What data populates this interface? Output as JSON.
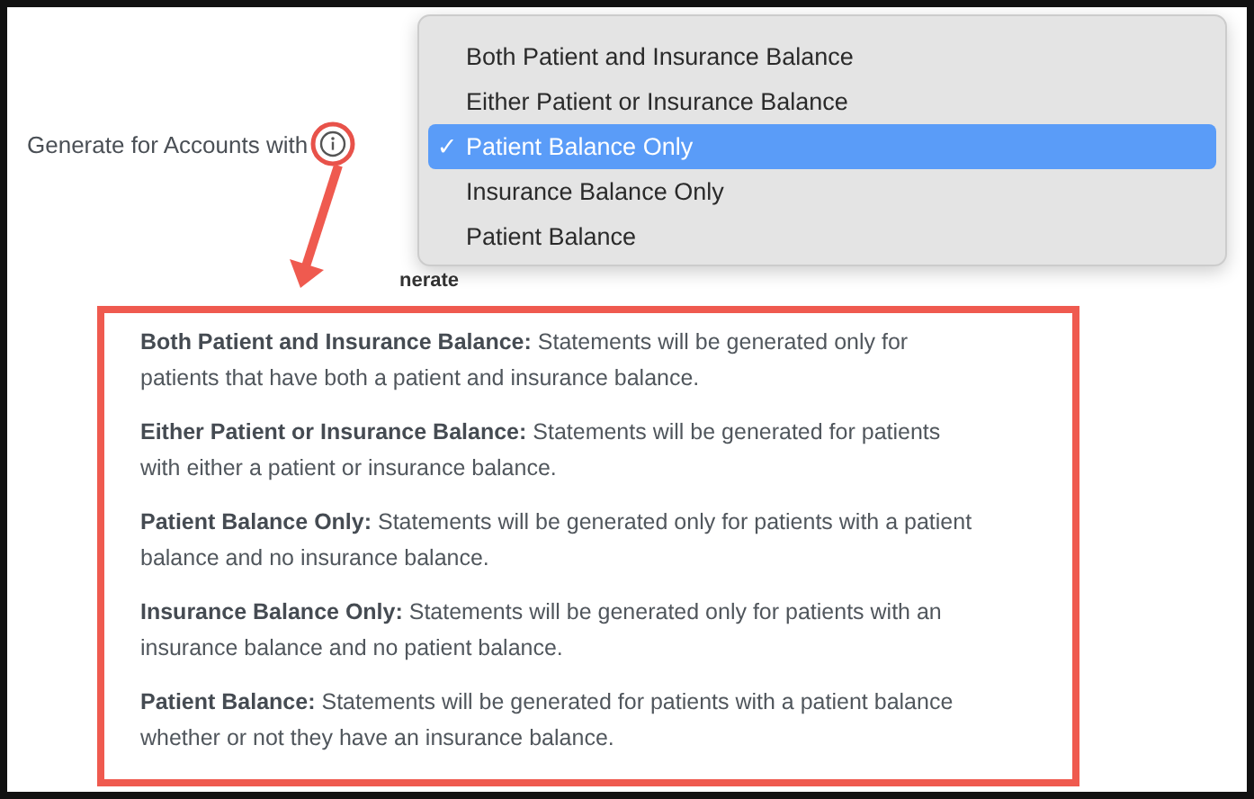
{
  "form": {
    "label": "Generate for Accounts with",
    "section_fragment": "nerate"
  },
  "dropdown": {
    "options": [
      {
        "label": "Both Patient and Insurance Balance",
        "selected": false
      },
      {
        "label": "Either Patient or Insurance Balance",
        "selected": false
      },
      {
        "label": "Patient Balance Only",
        "selected": true,
        "check": "✓"
      },
      {
        "label": "Insurance Balance Only",
        "selected": false
      },
      {
        "label": "Patient Balance",
        "selected": false
      }
    ]
  },
  "tooltip": {
    "entries": [
      {
        "text": "**Both Patient and Insurance Balance:** Statements will be generated only for patients that have both a patient and insurance balance."
      },
      {
        "text": "**Either Patient or Insurance Balance:** Statements will be generated for patients with either a patient or insurance balance."
      },
      {
        "text": "**Patient Balance Only:** Statements will be generated only for patients with a patient balance and no insurance balance."
      },
      {
        "text": "**Insurance Balance Only:** Statements will be generated only for patients with an insurance balance and no patient balance."
      },
      {
        "text": "**Patient Balance:** Statements will be generated for patients with a patient balance whether or not they have an insurance balance."
      }
    ]
  }
}
